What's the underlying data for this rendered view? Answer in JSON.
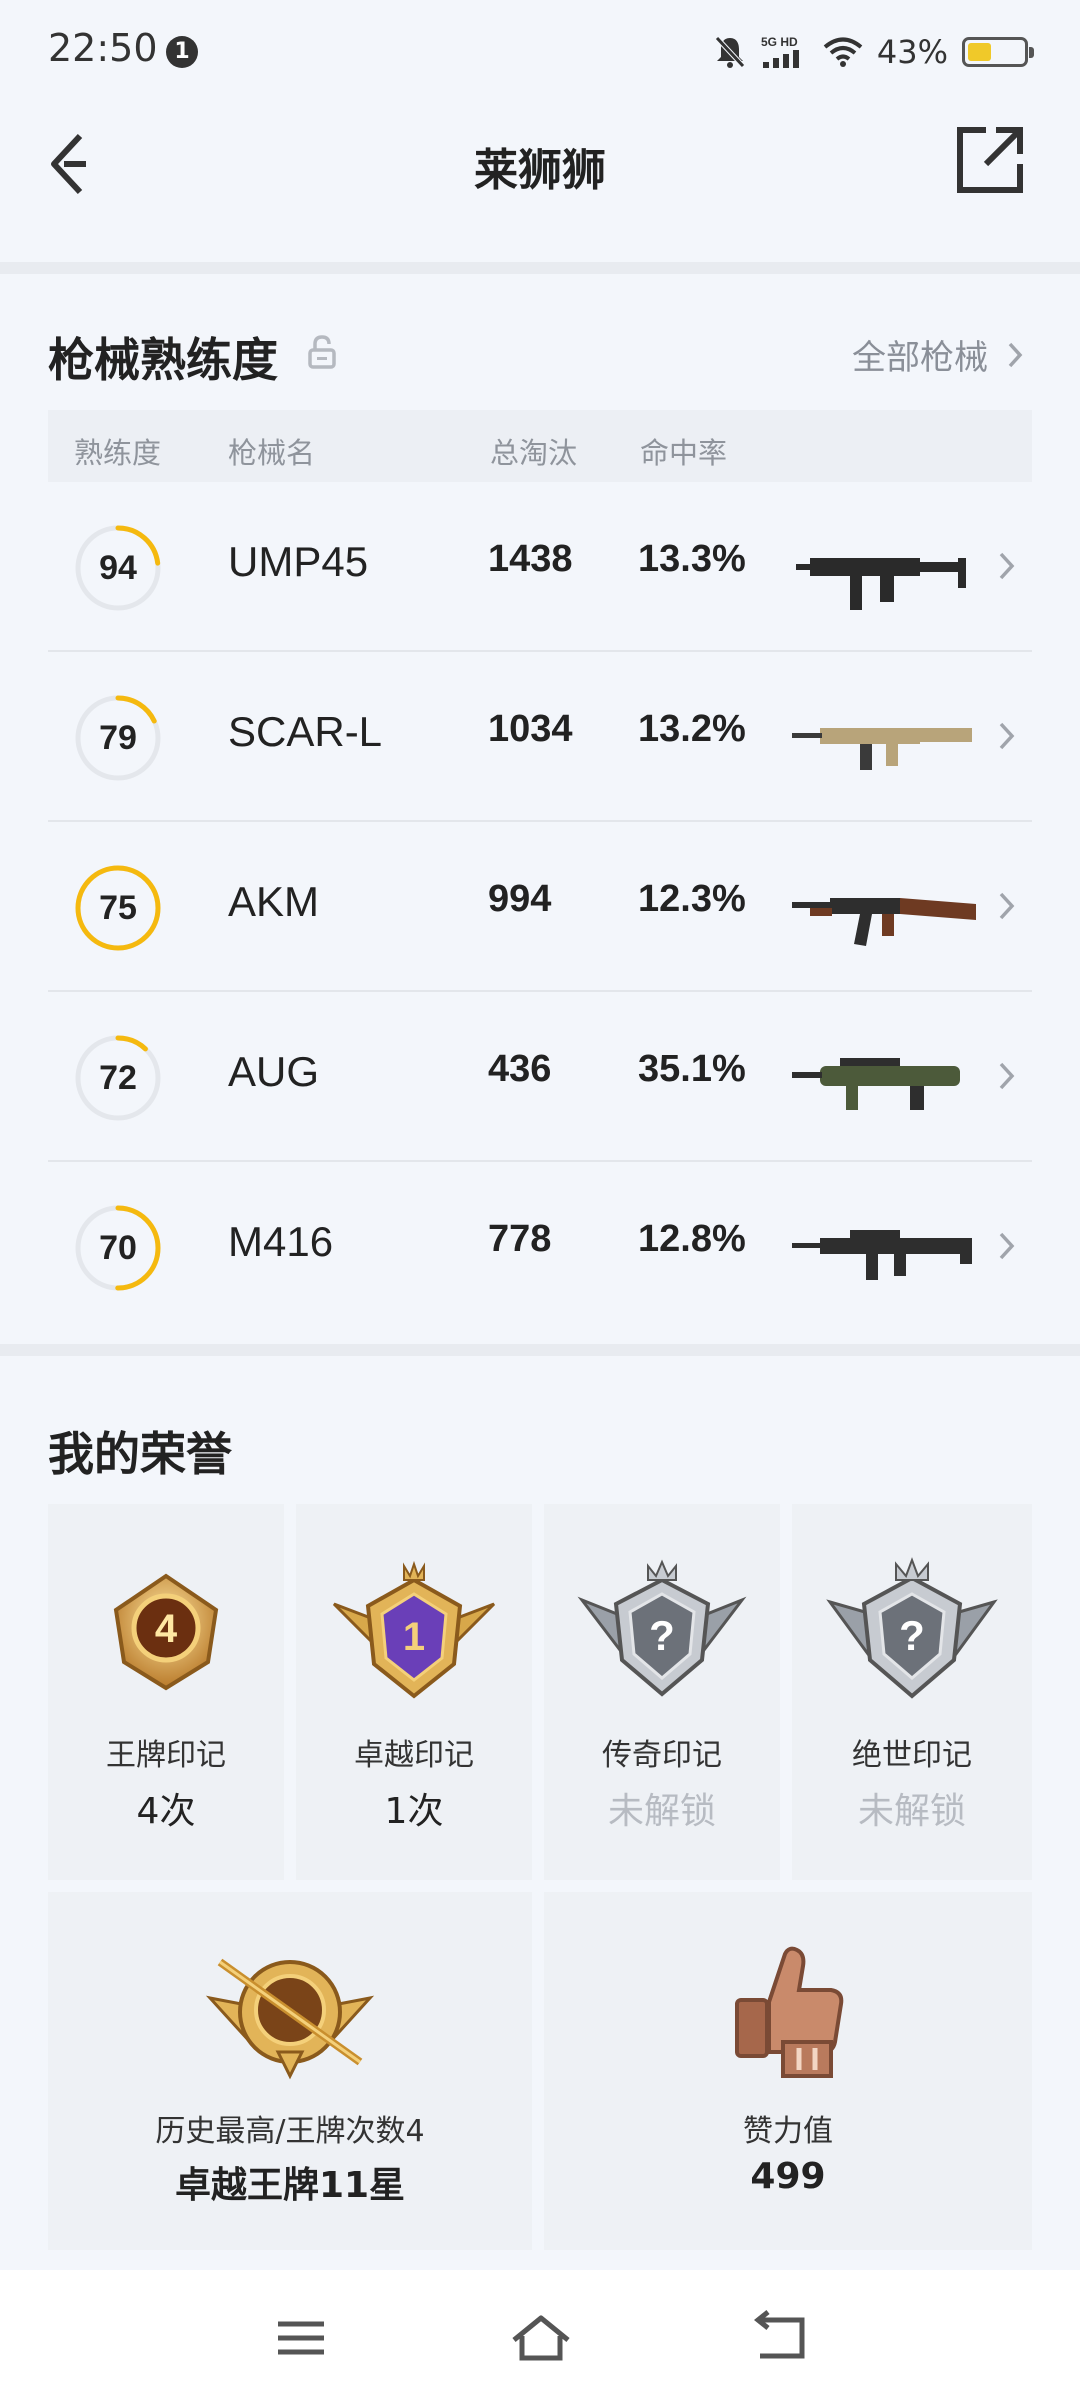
{
  "status_bar": {
    "time": "22:50",
    "notification_count": "1",
    "network": "5G HD",
    "battery_percent": "43%"
  },
  "header": {
    "title": "莱狮狮"
  },
  "weapons": {
    "section_title": "枪械熟练度",
    "all_link": "全部枪械",
    "columns": {
      "proficiency": "熟练度",
      "name": "枪械名",
      "kills": "总淘汰",
      "hit_rate": "命中率"
    },
    "rows": [
      {
        "proficiency": "94",
        "progress": 0.23,
        "name": "UMP45",
        "kills": "1438",
        "hit_rate": "13.3%",
        "icon": "ump45-gun-icon"
      },
      {
        "proficiency": "79",
        "progress": 0.18,
        "name": "SCAR-L",
        "kills": "1034",
        "hit_rate": "13.2%",
        "icon": "scar-l-gun-icon"
      },
      {
        "proficiency": "75",
        "progress": 1.0,
        "name": "AKM",
        "kills": "994",
        "hit_rate": "12.3%",
        "icon": "akm-gun-icon"
      },
      {
        "proficiency": "72",
        "progress": 0.12,
        "name": "AUG",
        "kills": "436",
        "hit_rate": "35.1%",
        "icon": "aug-gun-icon"
      },
      {
        "proficiency": "70",
        "progress": 0.5,
        "name": "M416",
        "kills": "778",
        "hit_rate": "12.8%",
        "icon": "m416-gun-icon"
      }
    ],
    "ring_color": "#f5b90f"
  },
  "honor": {
    "section_title": "我的荣誉",
    "cards": [
      {
        "name": "王牌印记",
        "value": "4次",
        "badge_number": "4"
      },
      {
        "name": "卓越印记",
        "value": "1次",
        "badge_number": "1"
      },
      {
        "name": "传奇印记",
        "value": "未解锁",
        "badge_number": "?"
      },
      {
        "name": "绝世印记",
        "value": "未解锁",
        "badge_number": "?"
      }
    ],
    "history": {
      "name": "历史最高/王牌次数4",
      "value": "卓越王牌11星"
    },
    "effort": {
      "name": "赞力值",
      "value": "499"
    }
  }
}
